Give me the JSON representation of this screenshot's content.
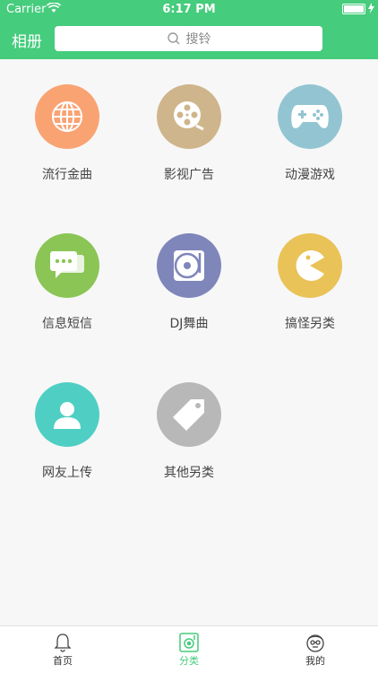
{
  "status": {
    "carrier": "Carrier",
    "time": "6:17 PM"
  },
  "nav": {
    "left_label": "相册",
    "search_placeholder": "搜铃"
  },
  "categories": [
    {
      "label": "流行金曲",
      "icon": "globe-icon",
      "color": "#f9a373"
    },
    {
      "label": "影视广告",
      "icon": "film-reel-icon",
      "color": "#cfb58b"
    },
    {
      "label": "动漫游戏",
      "icon": "gamepad-icon",
      "color": "#93c4d2"
    },
    {
      "label": "信息短信",
      "icon": "chat-bubbles-icon",
      "color": "#8bc556"
    },
    {
      "label": "DJ舞曲",
      "icon": "vinyl-disc-icon",
      "color": "#7f86ba"
    },
    {
      "label": "搞怪另类",
      "icon": "pacman-icon",
      "color": "#e9c258"
    },
    {
      "label": "网友上传",
      "icon": "user-icon",
      "color": "#4fcfc4"
    },
    {
      "label": "其他另类",
      "icon": "tag-icon",
      "color": "#b8b8b8"
    }
  ],
  "tabs": [
    {
      "label": "首页",
      "icon": "bell-icon",
      "active": false
    },
    {
      "label": "分类",
      "icon": "music-box-icon",
      "active": true
    },
    {
      "label": "我的",
      "icon": "face-icon",
      "active": false
    }
  ],
  "colors": {
    "accent": "#45cc7c"
  }
}
